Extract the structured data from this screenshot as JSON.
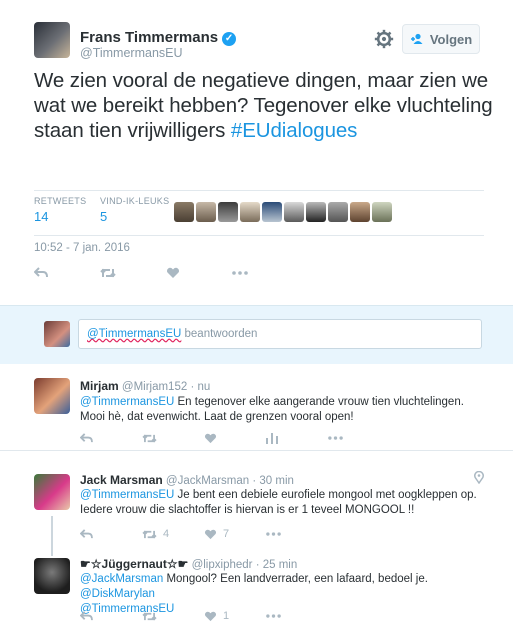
{
  "tweet": {
    "author_name": "Frans Timmermans",
    "author_handle": "@TimmermansEU",
    "follow_label": "Volgen",
    "text_main": "We zien vooral de negatieve dingen, maar zien we wat we bereikt hebben? Tegenover elke vluchteling staan tien vrijwilligers",
    "hashtag": "#EUdialogues",
    "retweets_label": "RETWEETS",
    "retweets_count": "14",
    "likes_label": "VIND-IK-LEUKS",
    "likes_count": "5",
    "timestamp": "10:52 - 7 jan. 2016"
  },
  "reply_box": {
    "mention": "@TimmermansEU",
    "suffix": " beantwoorden"
  },
  "replies": [
    {
      "name": "Mirjam",
      "handle": "@Mirjam152",
      "time": "· nu",
      "mention": "@TimmermansEU",
      "text": " En tegenover elke aangerande vrouw tien vluchtelingen. Mooi hè, dat evenwicht. Laat de grenzen vooral open!"
    },
    {
      "name": "Jack Marsman",
      "handle": "@JackMarsman",
      "time": "· 30 min",
      "mention": "@TimmermansEU",
      "text": " Je bent een debiele eurofiele mongool met oogkleppen op. Iedere vrouw die slachtoffer is hiervan is er 1 teveel MONGOOL !!",
      "retweets": "4",
      "likes": "7"
    },
    {
      "name": "☛☆Jüggernaut☆☛",
      "handle": "@lipxiphedr",
      "time": "· 25 min",
      "mention1": "@JackMarsman",
      "text1": " Mongool? Een landverrader, een lafaard, bedoel je. ",
      "mention2": "@DiskMarylan",
      "mention3": "@TimmermansEU",
      "likes": "1"
    }
  ],
  "colors": {
    "link": "#1b95e0",
    "muted": "#8899a6",
    "reply_bar_bg": "#e8f5fd",
    "verified": "#1da1f2"
  }
}
